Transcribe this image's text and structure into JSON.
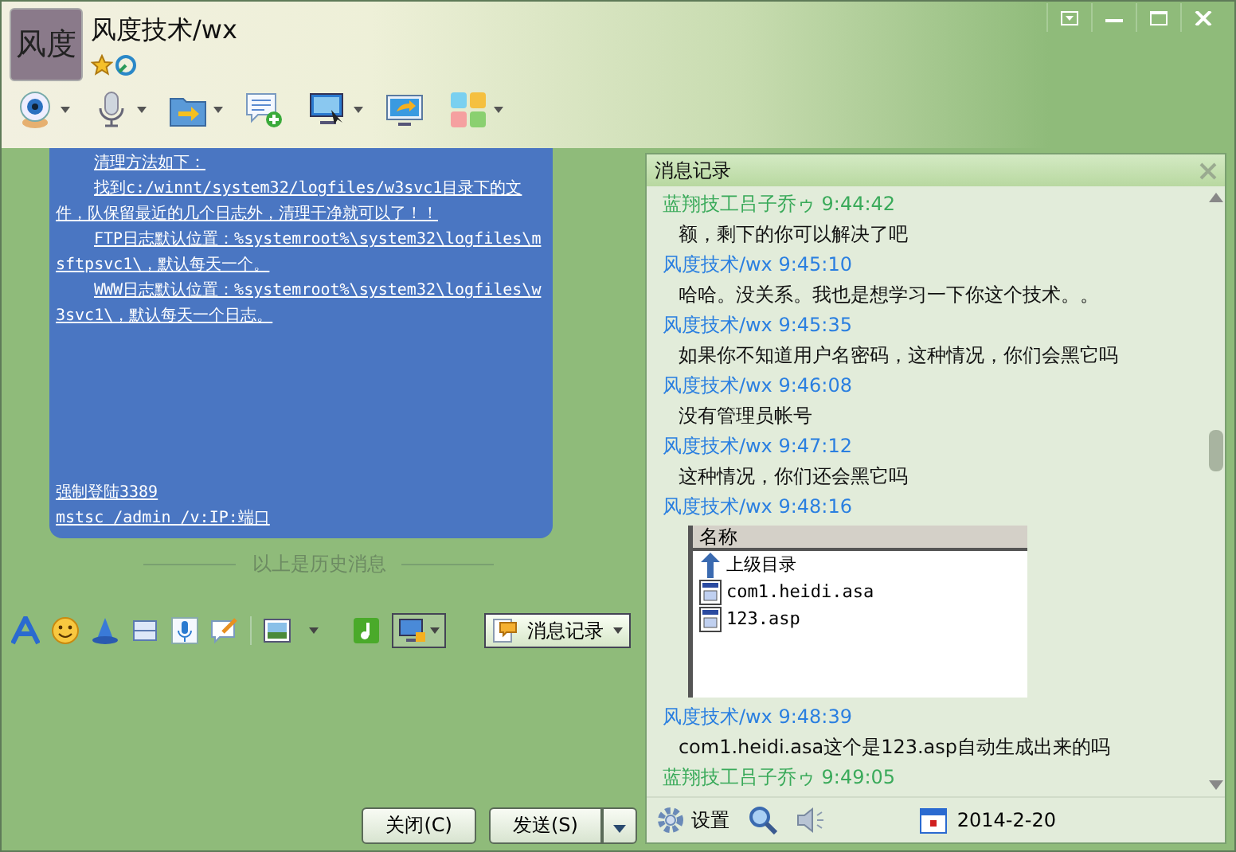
{
  "window": {
    "avatar_text": "风度",
    "title": "风度技术/wx"
  },
  "chat": {
    "paragraphs": [
      {
        "text": "清理方法如下："
      },
      {
        "text": "找到c:/winnt/system32/logfiles/w3svc1目录下的文件，队保留最近的几个日志外，清理干净就可以了！！"
      },
      {
        "text": "FTP日志默认位置：%systemroot%\\system32\\logfiles\\msftpsvc1\\，默认每天一个。"
      },
      {
        "text": "WWW日志默认位置：%systemroot%\\system32\\logfiles\\w3svc1\\，默认每天一个日志。"
      }
    ],
    "footer_lines": [
      "强制登陆3389",
      "mstsc /admin /v:IP:端口"
    ],
    "history_divider": "以上是历史消息"
  },
  "input_toolbar": {
    "history_button": "消息记录"
  },
  "buttons": [
    {
      "kind": "close",
      "label": "关闭(C)"
    },
    {
      "kind": "send",
      "label": "发送(S)"
    }
  ],
  "history_panel": {
    "title": "消息记录",
    "messages": [
      {
        "sender": "蓝翔技工吕子乔ゥ 9:44:42",
        "color": "#3aaa5a",
        "kind": "text",
        "text": "额，剩下的你可以解决了吧"
      },
      {
        "sender": "风度技术/wx 9:45:10",
        "color": "#2a7fe0",
        "kind": "text",
        "text": "哈哈。没关系。我也是想学习一下你这个技术。。"
      },
      {
        "sender": "风度技术/wx 9:45:35",
        "color": "#2a7fe0",
        "kind": "text",
        "text": "如果你不知道用户名密码，这种情况，你们会黑它吗"
      },
      {
        "sender": "风度技术/wx 9:46:08",
        "color": "#2a7fe0",
        "kind": "text",
        "text": "没有管理员帐号"
      },
      {
        "sender": "风度技术/wx 9:47:12",
        "color": "#2a7fe0",
        "kind": "text",
        "text": "这种情况，你们还会黑它吗"
      },
      {
        "sender": "风度技术/wx 9:48:16",
        "color": "#2a7fe0",
        "kind": "files",
        "header": "名称",
        "files": [
          {
            "kind": "up",
            "name": "上级目录"
          },
          {
            "kind": "file",
            "name": "com1.heidi.asa"
          },
          {
            "kind": "file",
            "name": "123.asp"
          }
        ]
      },
      {
        "sender": "风度技术/wx 9:48:39",
        "color": "#2a7fe0",
        "kind": "text",
        "text": "com1.heidi.asa这个是123.asp自动生成出来的吗"
      },
      {
        "sender": "蓝翔技工吕子乔ゥ 9:49:05",
        "color": "#3aaa5a",
        "kind": "none"
      }
    ],
    "settings_label": "设置",
    "date": "2014-2-20"
  }
}
